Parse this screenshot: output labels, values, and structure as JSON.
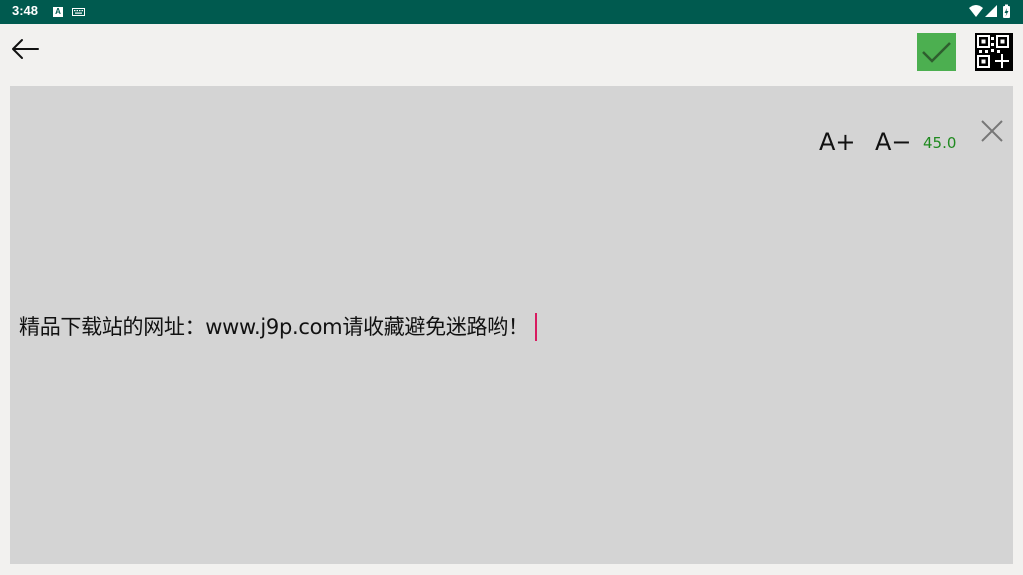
{
  "status_bar": {
    "time": "3:48",
    "a_icon_letter": "A",
    "background_color": "#005a4f"
  },
  "toolbar": {
    "back_icon": "arrow-left-icon",
    "confirm_icon": "checkmark-icon",
    "confirm_color": "#4caf50",
    "qr_add_icon": "qr-code-add-icon"
  },
  "editor": {
    "font_increase_label": "A+",
    "font_decrease_label": "A−",
    "font_size": "45.0",
    "font_size_color": "#1f8a1f",
    "close_icon": "close-icon",
    "text": "精品下载站的网址：www.j9p.com请收藏避免迷路哟！",
    "cursor_color": "#d81b60",
    "background_color": "#d4d4d4"
  }
}
